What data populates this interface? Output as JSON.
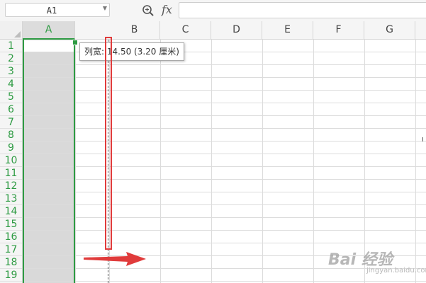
{
  "formula_bar": {
    "cell_reference": "A1",
    "fx_label": "fx",
    "formula_value": ""
  },
  "columns": [
    {
      "letter": "A",
      "selected": true
    },
    {
      "letter": "B",
      "selected": false
    },
    {
      "letter": "C",
      "selected": false
    },
    {
      "letter": "D",
      "selected": false
    },
    {
      "letter": "E",
      "selected": false
    },
    {
      "letter": "F",
      "selected": false
    },
    {
      "letter": "G",
      "selected": false
    }
  ],
  "rows": [
    "1",
    "2",
    "3",
    "4",
    "5",
    "6",
    "7",
    "8",
    "9",
    "10",
    "11",
    "12",
    "13",
    "14",
    "15",
    "16",
    "17",
    "18",
    "19"
  ],
  "tooltip": {
    "text": "列宽: 14.50 (3.20 厘米)"
  },
  "colors": {
    "selection_green": "#2e9b43",
    "highlight_red": "#e03b3b"
  },
  "watermark": {
    "brand": "Bai 经验",
    "sub": "jingyan.baidu.com"
  }
}
